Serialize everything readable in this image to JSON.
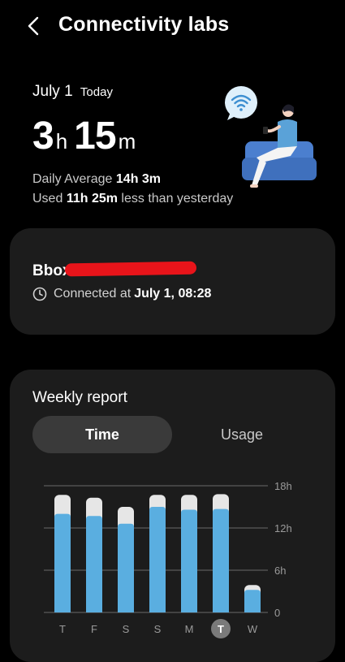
{
  "header": {
    "title": "Connectivity labs"
  },
  "summary": {
    "date": "July 1",
    "today_label": "Today",
    "hours": "3",
    "hours_unit": "h",
    "minutes": "15",
    "minutes_unit": "m",
    "daily_avg_label": "Daily Average",
    "daily_avg_value": "14h 3m",
    "used_label": "Used",
    "used_value": "11h 25m",
    "used_suffix": "less than yesterday"
  },
  "network": {
    "name": "Bbox-",
    "status_label": "Connected at",
    "status_time": "July 1, 08:28"
  },
  "weekly": {
    "title": "Weekly report",
    "tabs": [
      "Time",
      "Usage"
    ],
    "active_tab": "Time"
  },
  "colors": {
    "accent_bar": "#5aaee0",
    "bar_remainder": "#e6e6e6",
    "grid": "#6a6a6a",
    "card": "#1c1c1c"
  },
  "chart_data": {
    "type": "bar",
    "categories": [
      "T",
      "F",
      "S",
      "S",
      "M",
      "T",
      "W"
    ],
    "series": [
      {
        "values": [
          14.0,
          13.7,
          12.6,
          15.0,
          14.6,
          14.7,
          3.2
        ]
      },
      {
        "values": [
          2.7,
          2.6,
          2.4,
          1.7,
          2.1,
          2.1,
          0.7
        ]
      }
    ],
    "stacked": true,
    "ylim": [
      0,
      18
    ],
    "yticks": [
      "0",
      "6h",
      "12h",
      "18h"
    ],
    "highlighted_category_index": 5,
    "grid": true
  }
}
